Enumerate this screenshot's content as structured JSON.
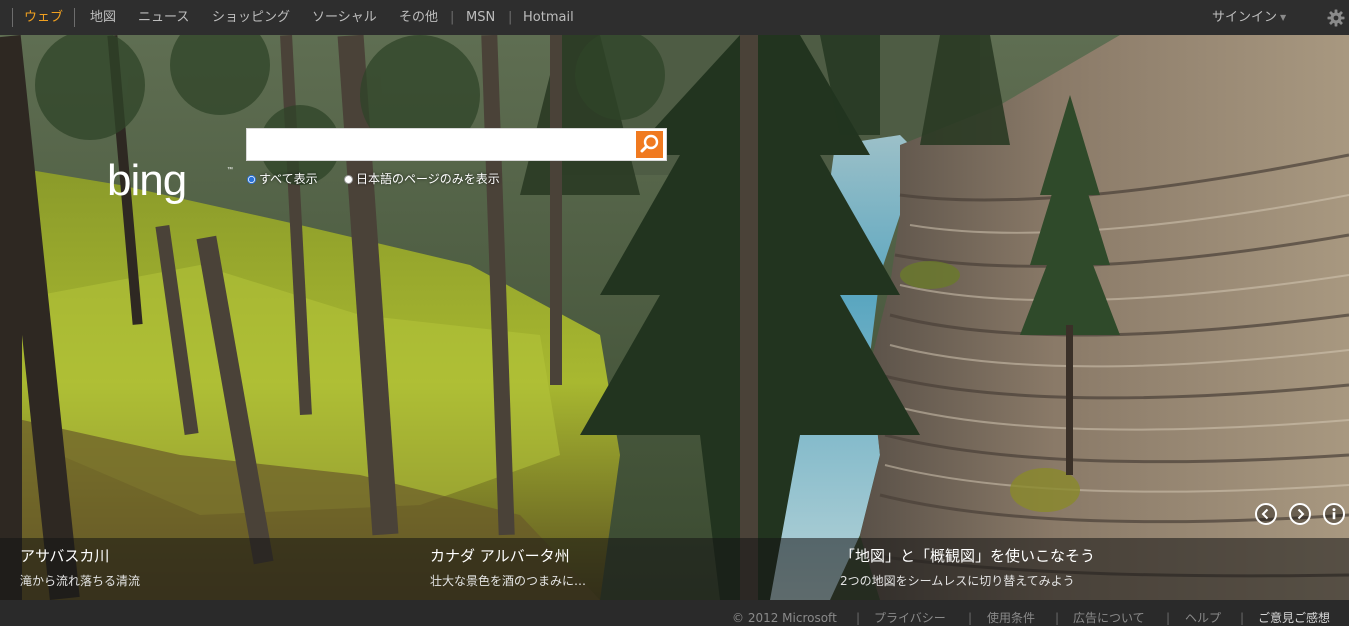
{
  "nav": {
    "items": [
      {
        "label": "ウェブ",
        "active": true
      },
      {
        "label": "地図"
      },
      {
        "label": "ニュース"
      },
      {
        "label": "ショッピング"
      },
      {
        "label": "ソーシャル"
      },
      {
        "label": "その他"
      },
      {
        "label": "MSN"
      },
      {
        "label": "Hotmail"
      }
    ],
    "separator": "|",
    "signin_label": "サインイン",
    "active_color": "#f0a020"
  },
  "search": {
    "logo_text": "bing",
    "value": "",
    "placeholder": "",
    "options": [
      {
        "label": "すべて表示",
        "selected": true
      },
      {
        "label": "日本語のページのみを表示",
        "selected": false
      }
    ],
    "button_icon": "search-icon",
    "button_color": "#f07a20"
  },
  "carousel": {
    "prev_icon": "chevron-left-icon",
    "next_icon": "chevron-right-icon",
    "info_icon": "info-icon"
  },
  "captions": [
    {
      "title": "アサバスカ川",
      "subtitle": "滝から流れ落ちる清流"
    },
    {
      "title": "カナダ アルバータ州",
      "subtitle": "壮大な景色を酒のつまみに…"
    },
    {
      "title": "「地図」と「概観図」を使いこなそう",
      "subtitle": "2つの地図をシームレスに切り替えてみよう"
    }
  ],
  "footer": {
    "copyright": "© 2012 Microsoft",
    "links": [
      "プライバシー",
      "使用条件",
      "広告について",
      "ヘルプ",
      "ご意見ご感想"
    ],
    "separator": "|"
  }
}
